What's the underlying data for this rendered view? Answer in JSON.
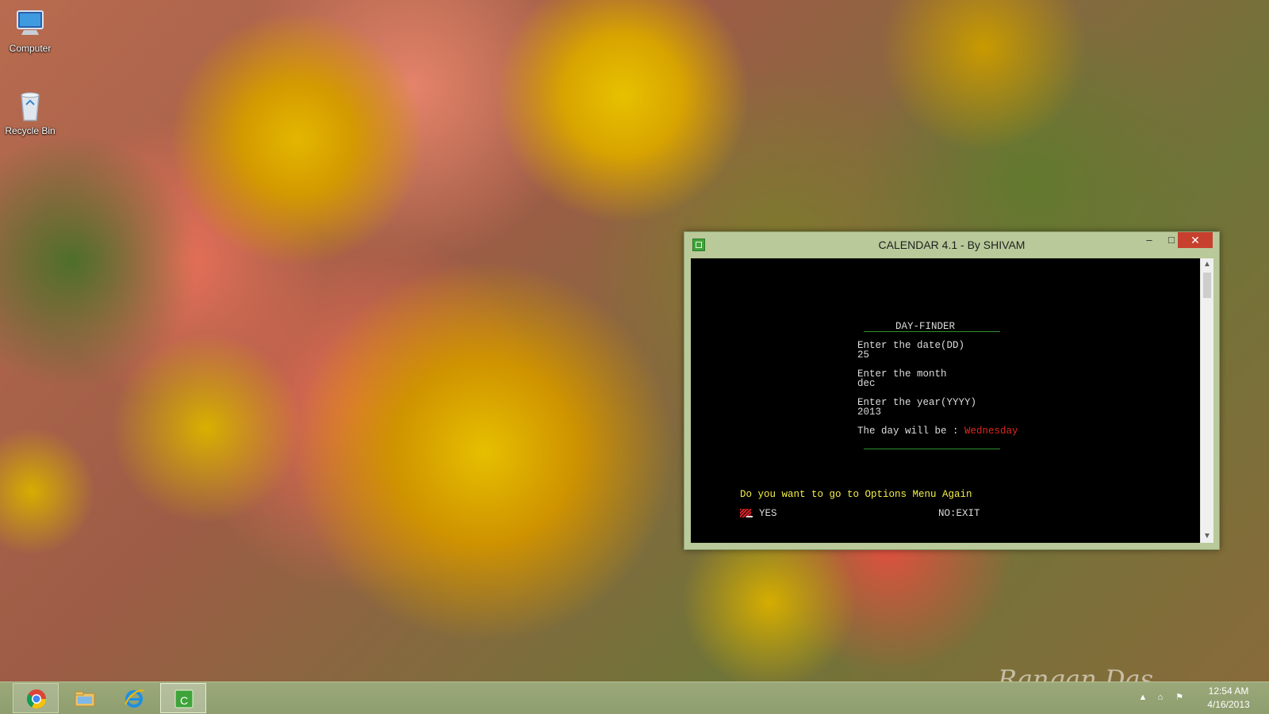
{
  "desktop": {
    "icons": [
      {
        "label": "Computer"
      },
      {
        "label": "Recycle Bin"
      }
    ],
    "signature": "Rangan Das"
  },
  "window": {
    "title": "CALENDAR 4.1 - By SHIVAM",
    "controls": {
      "minimize": "–",
      "maximize": "□",
      "close": "✕"
    },
    "console": {
      "heading": "DAY-FINDER",
      "date_prompt": "Enter the date(DD)",
      "date_value": "25",
      "month_prompt": "Enter the month",
      "month_value": "dec",
      "year_prompt": "Enter the year(YYYY)",
      "year_value": "2013",
      "result_prompt": "The day will be : ",
      "result_value": "Wednesday",
      "question": "Do you want to go to Options Menu Again",
      "yes_option": "YES",
      "no_option": "NO:EXIT"
    }
  },
  "taskbar": {
    "apps": [
      {
        "name": "chrome-icon"
      },
      {
        "name": "file-explorer-icon"
      },
      {
        "name": "internet-explorer-icon"
      },
      {
        "name": "calendar-app-icon"
      }
    ],
    "tray": {
      "chevron": "▲",
      "network": "⌂",
      "flag": "⚑"
    },
    "clock": {
      "time": "12:54 AM",
      "date": "4/16/2013"
    }
  },
  "colors": {
    "console_bg": "#000000",
    "result_red": "#e0281e",
    "prompt_yellow": "#f5ef4a",
    "titlebar": "#b9c99a",
    "close_red": "#c7402e",
    "rule_green": "#2f8f2f"
  }
}
